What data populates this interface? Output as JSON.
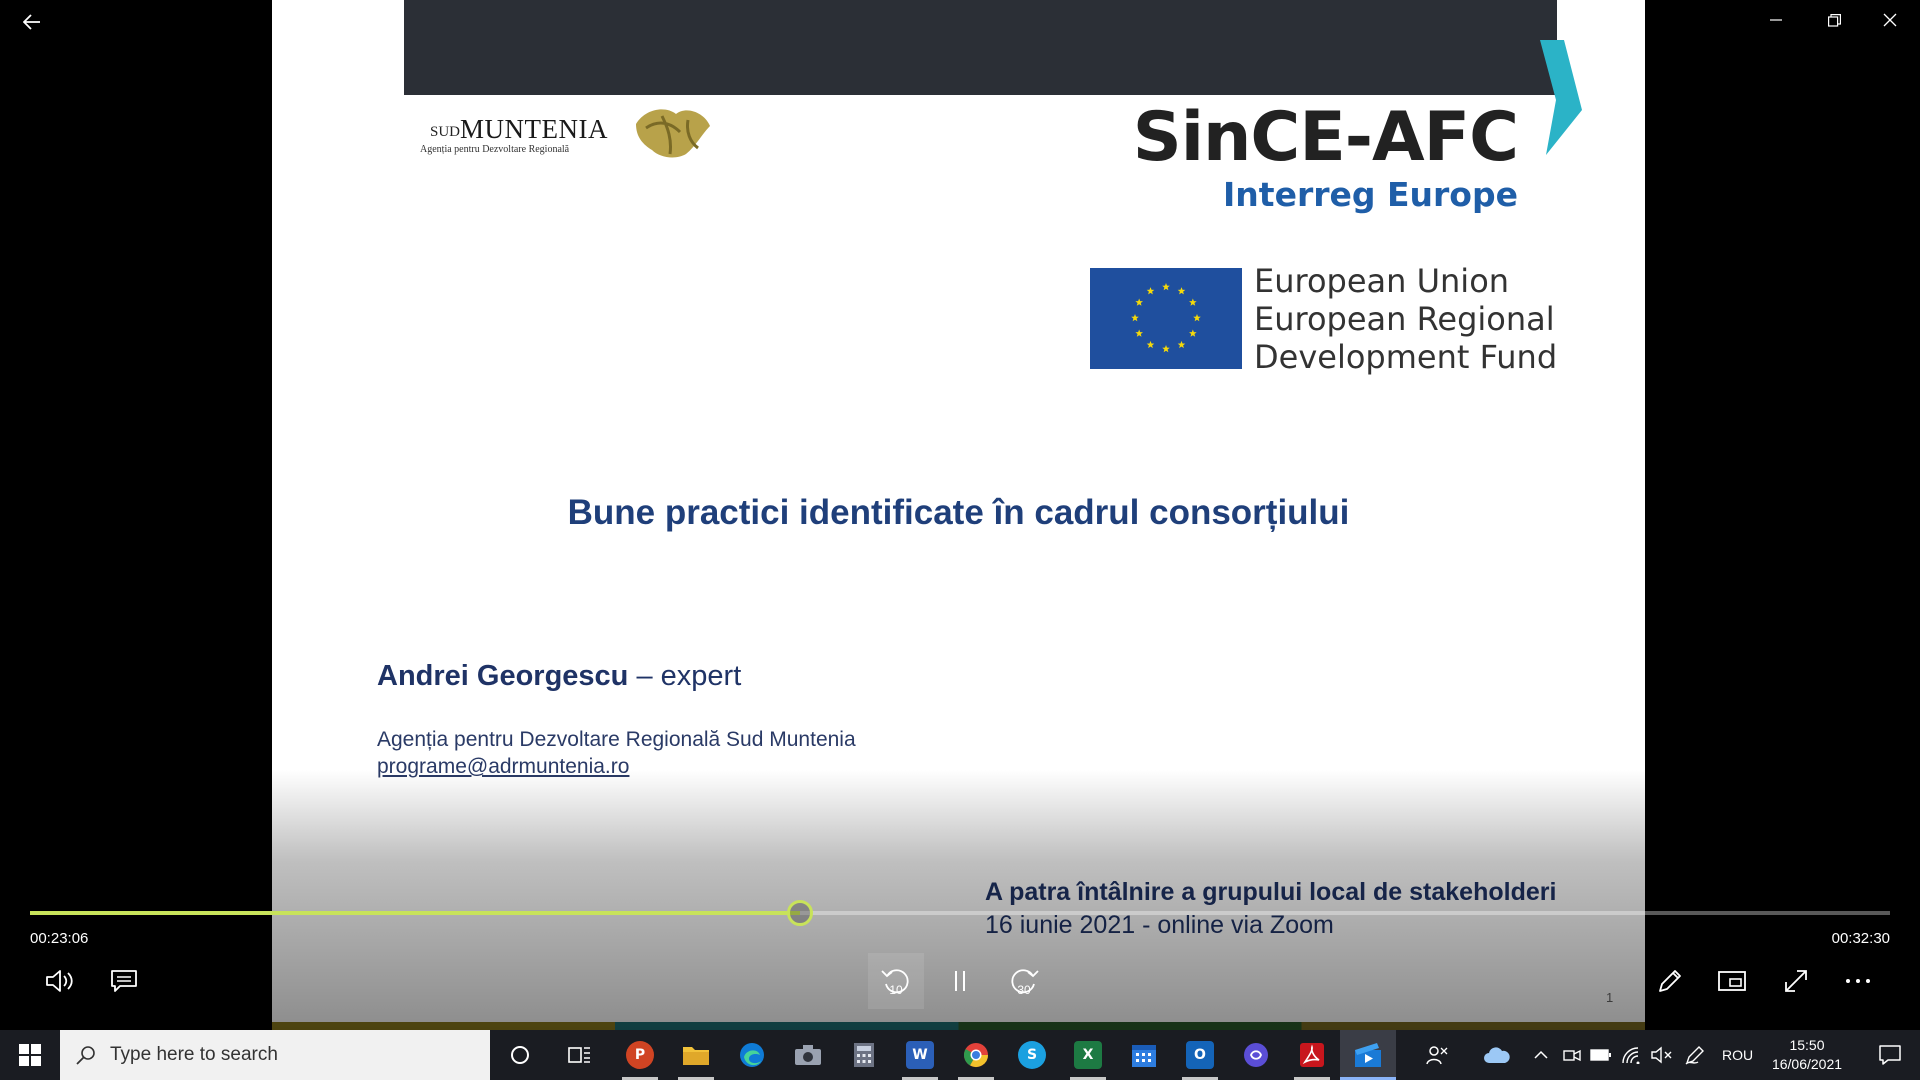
{
  "slide": {
    "logo_left": {
      "sud": "SUD",
      "muntenia": "MUNTENIA",
      "subtitle": "Agenția pentru Dezvoltare Regională"
    },
    "project_name": "SinCE-AFC",
    "program": "Interreg Europe",
    "eu_lines": [
      "European Union",
      "European Regional",
      "Development Fund"
    ],
    "title": "Bune practici identificate în cadrul consorțiului",
    "author_name": "Andrei Georgescu",
    "author_role": " – expert",
    "agency": "Agenția pentru Dezvoltare Regională Sud Muntenia",
    "email": "programe@adrmuntenia.ro",
    "meeting": "A patra întâlnire a grupului local de stakeholderi",
    "meeting_details": "16 iunie 2021  -  online  via Zoom",
    "page_number": "1"
  },
  "player": {
    "current_time": "00:23:06",
    "total_time": "00:32:30",
    "progress_percent": 41.4,
    "rewind_label": "10",
    "forward_label": "30"
  },
  "taskbar": {
    "search_placeholder": "Type here to search",
    "language": "ROU",
    "time": "15:50",
    "date": "16/06/2021"
  },
  "colors": {
    "accent": "#c8e35a",
    "slide_blue": "#1f3f7a",
    "interreg_blue": "#1f5ea8",
    "eu_blue": "#1f4f9e",
    "taskbar_bg": "#1a1c22"
  }
}
